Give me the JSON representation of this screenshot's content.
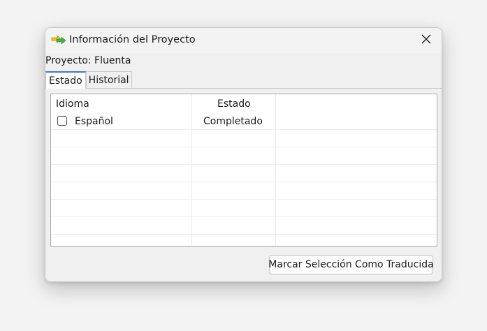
{
  "window": {
    "title": "Información del Proyecto",
    "app_icon": "arrow-app-icon",
    "close_icon": "close-icon"
  },
  "project": {
    "label": "Proyecto: Fluenta"
  },
  "tabs": [
    {
      "label": "Estado",
      "active": true
    },
    {
      "label": "Historial",
      "active": false
    }
  ],
  "table": {
    "columns": [
      "Idioma",
      "Estado"
    ],
    "rows": [
      {
        "checked": false,
        "language": "Español",
        "status": "Completado"
      }
    ]
  },
  "actions": {
    "mark_selection_label": "Marcar Selección Como Traducida"
  },
  "colors": {
    "tab_accent": "#3a7bd5",
    "icon_green": "#4caf50"
  }
}
